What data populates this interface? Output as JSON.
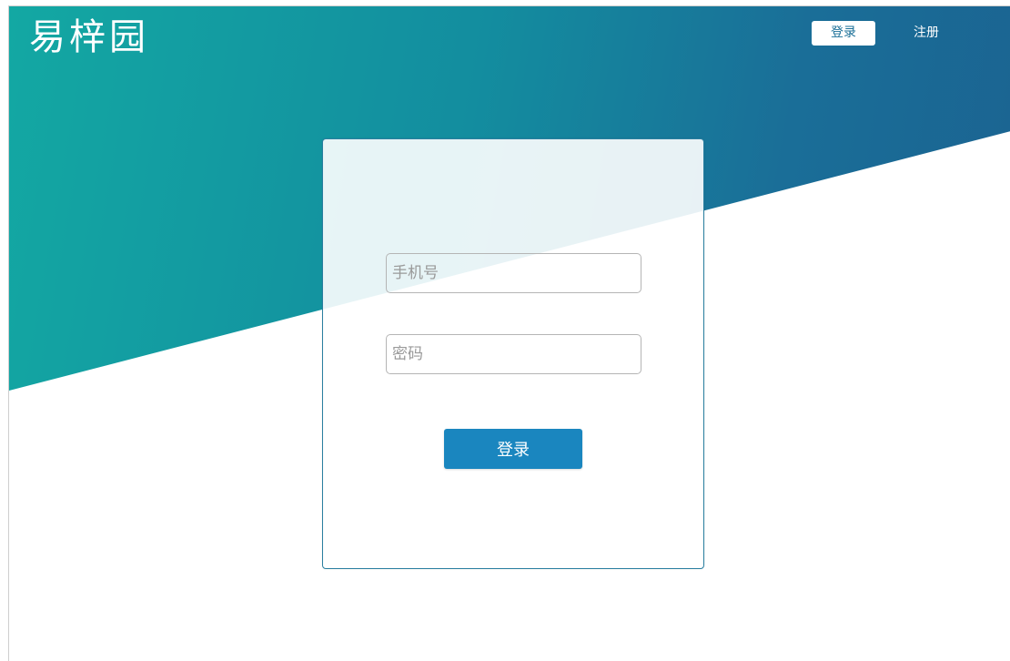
{
  "header": {
    "logo_text": "易梓园",
    "nav": {
      "login_label": "登录",
      "register_label": "注册"
    }
  },
  "login_form": {
    "phone": {
      "placeholder": "手机号",
      "value": ""
    },
    "password": {
      "placeholder": "密码",
      "value": ""
    },
    "submit_label": "登录"
  },
  "colors": {
    "hero_gradient_start": "#13a8a3",
    "hero_gradient_end": "#1b6391",
    "primary_button": "#1a86bf",
    "nav_login_text": "#1a6f97",
    "card_border": "#2a7fa0"
  }
}
